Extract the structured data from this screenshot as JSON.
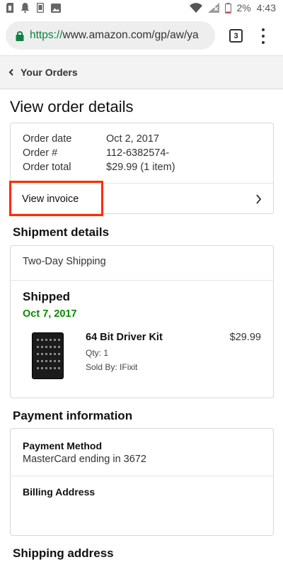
{
  "status_bar": {
    "battery": "2%",
    "time": "4:43"
  },
  "browser": {
    "url_scheme": "https://",
    "url_rest": "www.amazon.com/gp/aw/ya",
    "tab_count": "3"
  },
  "breadcrumb": {
    "label": "Your Orders"
  },
  "page": {
    "title": "View order details"
  },
  "order_summary": {
    "date_label": "Order date",
    "date_value": "Oct 2, 2017",
    "number_label": "Order #",
    "number_value": "112-6382574-",
    "total_label": "Order total",
    "total_value": "$29.99 (1 item)",
    "invoice_label": "View invoice"
  },
  "shipment": {
    "section_title": "Shipment details",
    "method": "Two-Day Shipping",
    "status": "Shipped",
    "date": "Oct 7, 2017",
    "item": {
      "name": "64 Bit Driver Kit",
      "price": "$29.99",
      "qty": "Qty: 1",
      "seller": "Sold By: IFixit"
    }
  },
  "payment": {
    "section_title": "Payment information",
    "method_label": "Payment Method",
    "method_value": "MasterCard ending in 3672",
    "billing_label": "Billing Address"
  },
  "shipping_address": {
    "section_title": "Shipping address"
  },
  "colors": {
    "highlight": "#ff2a00",
    "delivered_green": "#0b8a00",
    "secure_green": "#0b8043"
  }
}
